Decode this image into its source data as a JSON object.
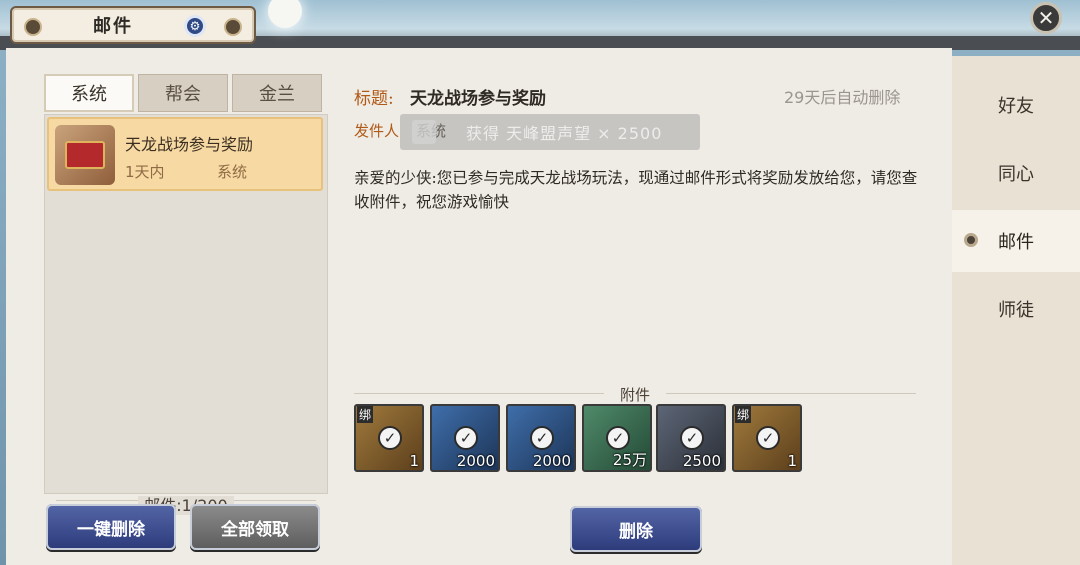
{
  "header": {
    "title": "邮件",
    "settings_icon": "gear-icon",
    "close_icon": "close-icon"
  },
  "tabs": [
    {
      "label": "系统",
      "active": true
    },
    {
      "label": "帮会",
      "active": false
    },
    {
      "label": "金兰",
      "active": false
    }
  ],
  "mail_list": [
    {
      "title": "天龙战场参与奖励",
      "time": "1天内",
      "sender": "系统",
      "icon": "reward-chest-icon",
      "selected": true
    }
  ],
  "mail_count": "邮件:1/200",
  "buttons": {
    "delete_all": "一键删除",
    "collect_all": "全部领取",
    "delete": "删除"
  },
  "mail_detail": {
    "subject_label": "标题:",
    "subject": "天龙战场参与奖励",
    "expire_note": "29天后自动删除",
    "sender_label": "发件人",
    "sender": "系统",
    "body": "亲爱的少侠:您已参与完成天龙战场玩法，现通过邮件形式将奖励发放给您，请您查收附件，祝您游戏愉快",
    "attachments_label": "附件",
    "attachments": [
      {
        "name": "card-item-icon",
        "qty": "1",
        "bound": true,
        "bind_label": "绑",
        "rarity": "gold"
      },
      {
        "name": "scroll-item-icon",
        "qty": "2000",
        "bound": false,
        "rarity": "blue"
      },
      {
        "name": "key-item-icon",
        "qty": "2000",
        "bound": false,
        "rarity": "blue"
      },
      {
        "name": "coin-item-icon",
        "qty": "25万",
        "bound": false,
        "rarity": "green"
      },
      {
        "name": "sword-item-icon",
        "qty": "2500",
        "bound": false,
        "rarity": "dark"
      },
      {
        "name": "chest-item-icon",
        "qty": "1",
        "bound": true,
        "bind_label": "绑",
        "rarity": "gold"
      }
    ]
  },
  "toast": {
    "text": "获得 天峰盟声望 × 2500"
  },
  "side_nav": [
    {
      "label": "好友",
      "active": false
    },
    {
      "label": "同心",
      "active": false
    },
    {
      "label": "邮件",
      "active": true
    },
    {
      "label": "师徒",
      "active": false
    }
  ]
}
